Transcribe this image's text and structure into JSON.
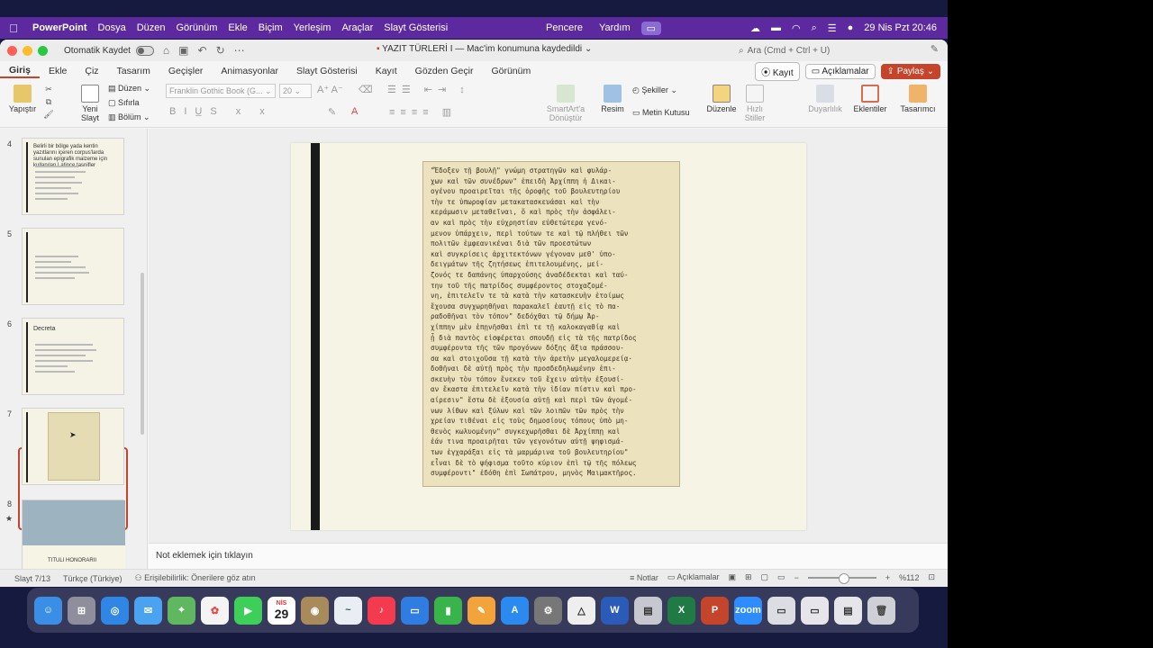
{
  "menubar": {
    "app": "PowerPoint",
    "items": [
      "Dosya",
      "Düzen",
      "Görünüm",
      "Ekle",
      "Biçim",
      "Yerleşim",
      "Araçlar",
      "Slayt Gösterisi"
    ],
    "mid_items": [
      "Pencere",
      "Yardım"
    ],
    "clock": "29 Nis Pzt  20:46"
  },
  "titlebar": {
    "autosave_label": "Otomatik Kaydet",
    "doc_title": "YAZIT TÜRLERİ I — Mac'im konumuna kaydedildi",
    "search_placeholder": "Ara (Cmd + Ctrl + U)"
  },
  "tabs": [
    "Giriş",
    "Ekle",
    "Çiz",
    "Tasarım",
    "Geçişler",
    "Animasyonlar",
    "Slayt Gösterisi",
    "Kayıt",
    "Gözden Geçir",
    "Görünüm"
  ],
  "tab_actions": {
    "record": "Kayıt",
    "comments": "Açıklamalar",
    "share": "Paylaş"
  },
  "ribbon": {
    "paste": "Yapıştır",
    "new_slide_line1": "Yeni",
    "new_slide_line2": "Slayt",
    "layout": "Düzen",
    "reset": "Sıfırla",
    "section": "Bölüm",
    "font_name": "Franklin Gothic Book (G...",
    "font_size": "20",
    "smartart_line1": "SmartArt'a",
    "smartart_line2": "Dönüştür",
    "picture": "Resim",
    "shapes": "Şekiller",
    "textbox": "Metin Kutusu",
    "arrange": "Düzenle",
    "quick_styles_line1": "Hızlı",
    "quick_styles_line2": "Stiller",
    "sensitivity": "Duyarlılık",
    "addins": "Eklentiler",
    "designer": "Tasarımcı"
  },
  "thumbnails": [
    {
      "num": "4",
      "title": "Belirli bir bölge yada kentin yazıtlarını içeren corpus'larda sunulan epigrafik malzeme için kullanılan Latince tasnifler"
    },
    {
      "num": "5",
      "title": ""
    },
    {
      "num": "6",
      "title": "Decreta"
    },
    {
      "num": "7",
      "title": ""
    },
    {
      "num": "8",
      "title": "TITULI HONORARII"
    }
  ],
  "inscription_lines": [
    "\"Ἔδοξεν τῇ βουλῇ\" γνώμη στρατηγῶν καὶ φυλάρ-",
    "χων καὶ τῶν συνέδρων\" ἐπειδὴ Ἀρχίππη ἡ Δικαι-",
    "ογένου προαιρεῖται τῆς ὀροφῆς τοῦ βουλευτηρίου",
    "τὴν τε ὑπωροφίαν μετακατασκευάσαι καὶ τὴν",
    "κεράμωσιν μεταθεῖναι, ὅ καὶ πρὸς τὴν ἀσφάλει-",
    "αν καὶ πρὸς τὴν εὐχρηστίαν εὐθετώτερα γενό-",
    "μενον ὑπάρχειν, περὶ τούτων τε καὶ τῷ πλήθει τῶν",
    "πολιτῶν ἐμφεανικέναι διὰ τῶν προεστώτων",
    "καὶ συγκρίσεις ἀρχιτεκτόνων γέγοναν μεθ' ὑπο-",
    "δειγμάτων τῆς ζητήσεως ἐπιτελουμένης, μεί-",
    "ζονός τε δαπάνης ὑπαρχούσης ἀναδέδεκται καὶ ταύ-",
    "την τοῦ τῆς πατρίδος συμφέροντος στοχαζομέ-",
    "νη, ἐπιτελεῖν τε τὰ κατὰ τὴν κατασκευὴν ἑτοίμως",
    "ἔχουσα συγχωρηθῆναι παρακαλεῖ ἑαυτῇ εἰς τὸ πα-",
    "ραδοθῆναι τὸν τόπον\" δεδόχθαι τῷ δήμῳ Ἀρ-",
    "χίππην μὲν ἐπῃνῆσθαι ἐπὶ τε τῇ καλοκαγαθίᾳ καὶ",
    "ᾗ διὰ παντὸς εἰσφέρεται σπουδῇ εἰς τὰ τῆς πατρίδος",
    "συμφέροντα τῆς τῶν προγόνων δόξης ἄξια πράσσου-",
    "σα καὶ στοιχοῦσα τῇ κατὰ τὴν ἀρετὴν μεγαλομερείᾳ·",
    "δοθῆναι δὲ αὐτῇ πρὸς τὴν προσδεδηλωμένην ἐπι-",
    "σκευὴν τὸν τόπον ἕνεκεν τοῦ ἔχειν αὐτὴν ἐξουσί-",
    "αν ἕκαστα ἐπιτελεῖν κατὰ τὴν ἰδίαν πίστιν καὶ προ-",
    "αίρεσιν\" ἔστω δὲ ἐξουσία αὐτῇ καὶ περὶ τῶν ἀγομέ-",
    "νων λίθων καὶ ξύλων καὶ τῶν λοιπῶν τῶν πρὸς τὴν",
    "χρείαν τιθέναι εἰς τοὺς δημοσίους τόπους ὑπὸ μη-",
    "θενὸς κωλυομένην\" συγκεχωρῆσθαι δὲ Ἀρχίππῃ καὶ",
    "ἐάν τινα προαιρῆται τῶν γεγονότων αὐτῇ ψηφισμά-",
    "των ἐγχαράξαι εἰς τὰ μαρμάρινα τοῦ βουλευτηρίου\"",
    "εἶναι δὲ τὸ ψήφισμα τοῦτο κύριον ἐπὶ τῷ τῆς πόλεως",
    "συμφέροντι\" ἐδόθη ἐπὶ Σωπάτρου, μηνὸς Μαιμακτῆρος."
  ],
  "notes_placeholder": "Not eklemek için tıklayın",
  "status": {
    "slide": "Slayt 7/13",
    "language": "Türkçe (Türkiye)",
    "accessibility": "Erişilebilirlik: Önerilere göz atın",
    "notes": "Notlar",
    "comments": "Açıklamalar",
    "zoom": "%112"
  },
  "dock": {
    "calendar_month": "NİS",
    "calendar_day": "29"
  },
  "colors": {
    "menubar": "#5c2a9e",
    "accent": "#c4452b",
    "slide_bg": "#f6f5e5",
    "inscription_bg": "#ece2be"
  }
}
